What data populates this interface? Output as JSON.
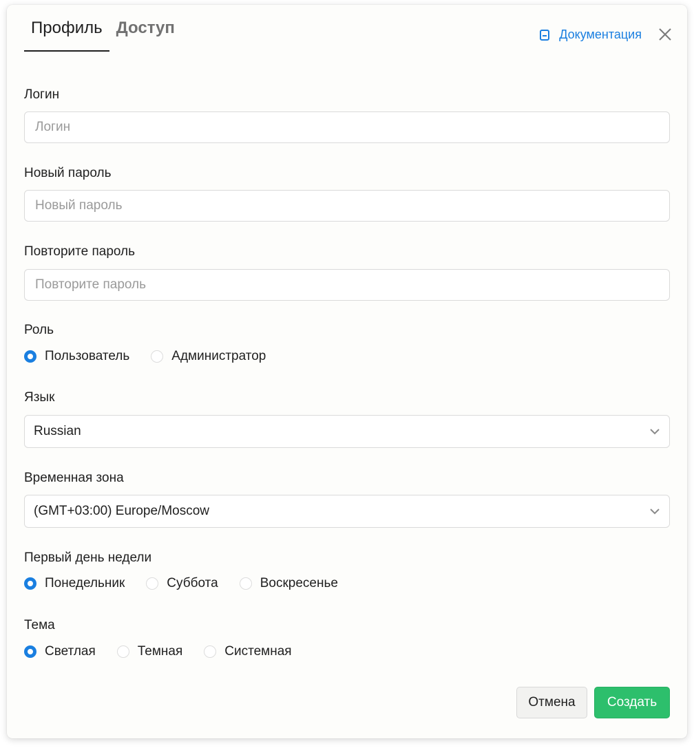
{
  "tabs": [
    {
      "label": "Профиль",
      "active": true
    },
    {
      "label": "Доступ",
      "active": false
    }
  ],
  "header": {
    "doc_link_label": "Документация",
    "doc_icon": "book-icon",
    "close_icon": "close-icon"
  },
  "fields": {
    "login": {
      "label": "Логин",
      "placeholder": "Логин",
      "value": ""
    },
    "new_password": {
      "label": "Новый пароль",
      "placeholder": "Новый пароль",
      "value": ""
    },
    "repeat_password": {
      "label": "Повторите пароль",
      "placeholder": "Повторите пароль",
      "value": ""
    }
  },
  "role": {
    "label": "Роль",
    "options": [
      "Пользователь",
      "Администратор"
    ],
    "selected": "Пользователь"
  },
  "language": {
    "label": "Язык",
    "value": "Russian"
  },
  "timezone": {
    "label": "Временная зона",
    "value": "(GMT+03:00) Europe/Moscow"
  },
  "first_day": {
    "label": "Первый день недели",
    "options": [
      "Понедельник",
      "Суббота",
      "Воскресенье"
    ],
    "selected": "Понедельник"
  },
  "theme": {
    "label": "Тема",
    "options": [
      "Светлая",
      "Темная",
      "Системная"
    ],
    "selected": "Светлая"
  },
  "actions": {
    "cancel_label": "Отмена",
    "create_label": "Создать"
  },
  "colors": {
    "accent": "#1a7fe0",
    "primary_button": "#2dbf6c"
  }
}
